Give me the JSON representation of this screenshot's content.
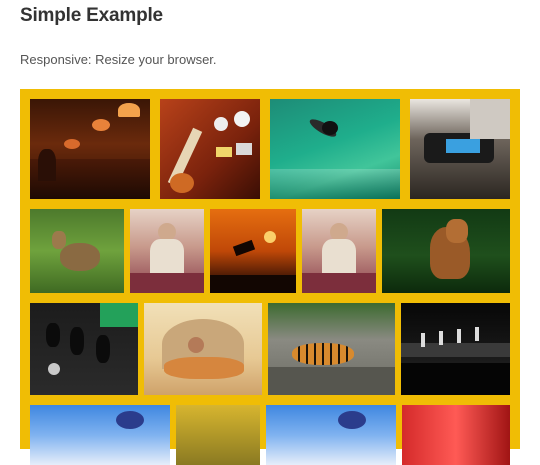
{
  "page": {
    "title": "Simple Example",
    "subtitle": "Responsive: Resize your browser."
  },
  "colors": {
    "gallery_background": "#f0bd05",
    "title_text": "#333333",
    "subtitle_text": "#555555"
  },
  "gallery": {
    "photos": [
      {
        "subject": "restaurant-interior-with-lamps"
      },
      {
        "subject": "wall-of-guitars-and-signs"
      },
      {
        "subject": "surfer-on-green-wave"
      },
      {
        "subject": "sony-digital-device"
      },
      {
        "subject": "deer-in-grass"
      },
      {
        "subject": "seated-person-portrait"
      },
      {
        "subject": "soccer-kick-silhouette-at-sunset"
      },
      {
        "subject": "seated-person-portrait"
      },
      {
        "subject": "horse-in-forest"
      },
      {
        "subject": "circuit-board-capacitors"
      },
      {
        "subject": "woman-reclining-painting"
      },
      {
        "subject": "tiger-lying-on-rock"
      },
      {
        "subject": "fashion-runway"
      },
      {
        "subject": "bmx-rider-sky"
      },
      {
        "subject": "yellow-flowers"
      },
      {
        "subject": "bmx-rider-sky"
      },
      {
        "subject": "red-abstract"
      }
    ]
  }
}
